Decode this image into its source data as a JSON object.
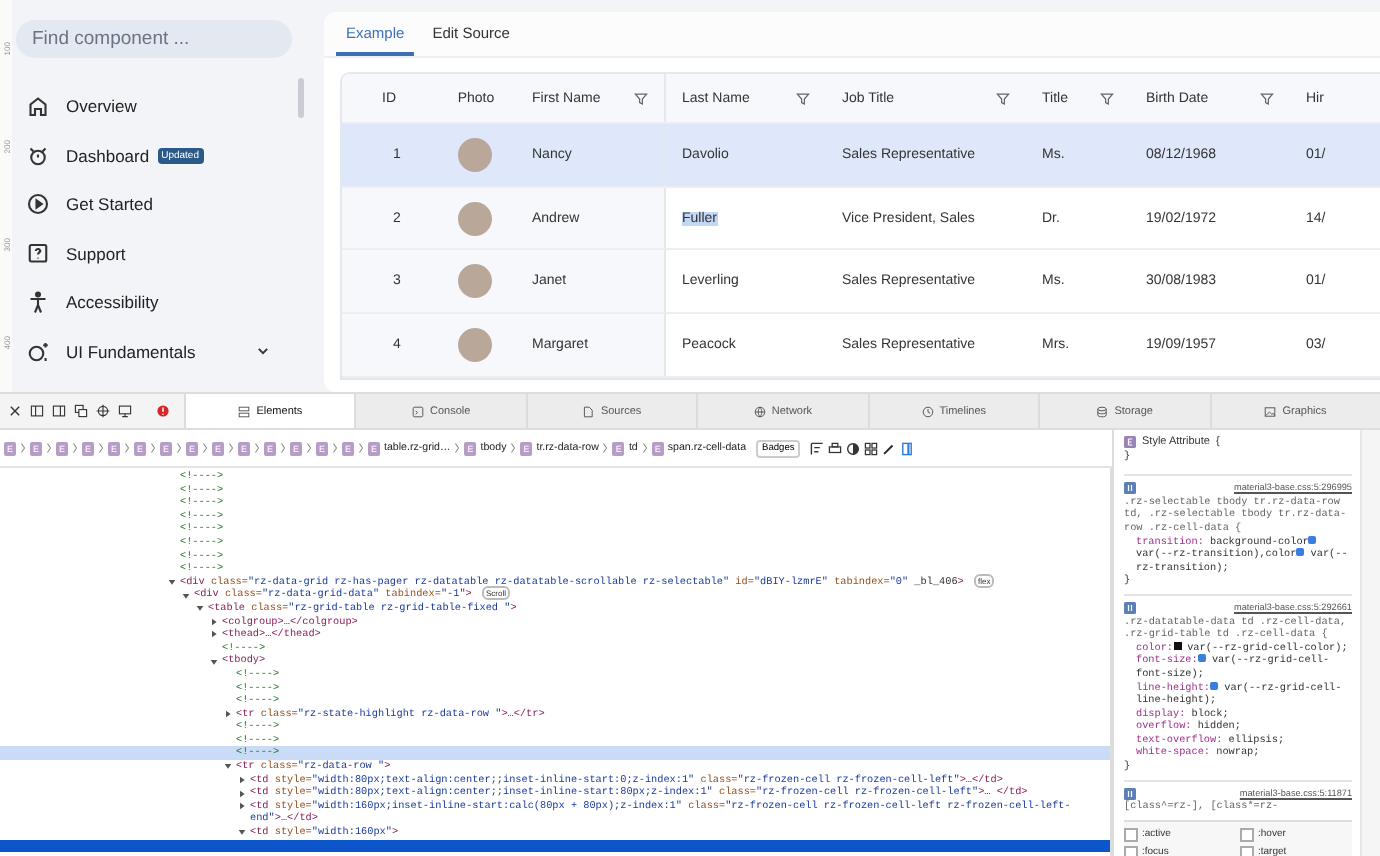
{
  "ruler": [
    "100",
    "200",
    "300",
    "400"
  ],
  "sidebar": {
    "search": {
      "placeholder": "Find component ..."
    },
    "items": [
      {
        "label": "Overview"
      },
      {
        "label": "Dashboard",
        "badge": "Updated"
      },
      {
        "label": "Get Started"
      },
      {
        "label": "Support"
      },
      {
        "label": "Accessibility"
      },
      {
        "label": "UI Fundamentals",
        "expanded": false
      }
    ]
  },
  "tabs": [
    {
      "label": "Example",
      "selected": true
    },
    {
      "label": "Edit Source",
      "selected": false
    }
  ],
  "grid": {
    "columns": [
      {
        "label": "ID",
        "filter": false
      },
      {
        "label": "Photo",
        "filter": false
      },
      {
        "label": "First Name",
        "filter": true
      },
      {
        "label": "Last Name",
        "filter": true
      },
      {
        "label": "Job Title",
        "filter": true
      },
      {
        "label": "Title",
        "filter": true
      },
      {
        "label": "Birth Date",
        "filter": true
      },
      {
        "label": "Hir",
        "filter": false
      }
    ],
    "rows": [
      {
        "selected": true,
        "cells": [
          "1",
          "",
          "Nancy",
          "Davolio",
          "Sales Representative",
          "Ms.",
          "08/12/1968",
          "01/"
        ]
      },
      {
        "selected": false,
        "text_selected": true,
        "cells": [
          "2",
          "",
          "Andrew",
          "Fuller",
          "Vice President, Sales",
          "Dr.",
          "19/02/1972",
          "14/"
        ]
      },
      {
        "selected": false,
        "cells": [
          "3",
          "",
          "Janet",
          "Leverling",
          "Sales Representative",
          "Ms.",
          "30/08/1983",
          "01/"
        ]
      },
      {
        "selected": false,
        "cells": [
          "4",
          "",
          "Margaret",
          "Peacock",
          "Sales Representative",
          "Mrs.",
          "19/09/1957",
          "03/"
        ]
      }
    ]
  },
  "devtools": {
    "tabs": [
      {
        "label": "Elements",
        "selected": true
      },
      {
        "label": "Console",
        "selected": false
      },
      {
        "label": "Sources",
        "selected": false
      },
      {
        "label": "Network",
        "selected": false
      },
      {
        "label": "Timelines",
        "selected": false
      },
      {
        "label": "Storage",
        "selected": false
      },
      {
        "label": "Graphics",
        "selected": false
      }
    ],
    "breadcrumb": [
      {
        "badge": "E"
      },
      {
        "badge": "E"
      },
      {
        "badge": "E"
      },
      {
        "badge": "E"
      },
      {
        "badge": "E"
      },
      {
        "badge": "E"
      },
      {
        "badge": "E"
      },
      {
        "badge": "E"
      },
      {
        "badge": "E"
      },
      {
        "badge": "E"
      },
      {
        "badge": "E"
      },
      {
        "badge": "E"
      },
      {
        "badge": "E"
      },
      {
        "badge": "E"
      },
      {
        "badge": "E",
        "label": "table.rz-grid…"
      },
      {
        "badge": "E",
        "label": "tbody"
      },
      {
        "badge": "E",
        "label": "tr.rz-data-row"
      },
      {
        "badge": "E",
        "label": "td"
      },
      {
        "badge": "E",
        "label": "span.rz-cell-data"
      }
    ],
    "badges_button": "Badges",
    "dom": [
      {
        "text": "<!---->"
      },
      {
        "text": "<!---->"
      },
      {
        "text": "<!---->"
      },
      {
        "text": "<!---->"
      },
      {
        "text": "<!---->"
      },
      {
        "text": "<!---->"
      },
      {
        "text": "<!---->"
      },
      {
        "text": "<!---->"
      },
      {
        "text": "<div class=\"rz-data-grid rz-has-pager rz-datatable rz-datatable-scrollable rz-selectable\" id=\"dBIY-lzmrE\" tabindex=\"0\" _bl_406>",
        "badge": "flex",
        "expanded": true,
        "children": [
          {
            "text": "<div class=\"rz-data-grid-data\" tabindex=\"-1\">",
            "badge": "Scroll",
            "expanded": true,
            "children": [
              {
                "text": "<table class=\"rz-grid-table rz-grid-table-fixed \">",
                "expanded": true,
                "children": [
                  {
                    "text": "<colgroup>…</colgroup>",
                    "expanded": false
                  },
                  {
                    "text": "<thead>…</thead>",
                    "expanded": false
                  },
                  {
                    "text": "<!---->"
                  },
                  {
                    "text": "<tbody>",
                    "expanded": true,
                    "children": [
                      {
                        "text": "<!---->"
                      },
                      {
                        "text": "<!---->"
                      },
                      {
                        "text": "<!---->"
                      },
                      {
                        "text": "<tr class=\"rz-state-highlight rz-data-row \">…</tr>",
                        "expanded": false
                      },
                      {
                        "text": "<!---->"
                      },
                      {
                        "text": "<!---->"
                      },
                      {
                        "text": "<!---->",
                        "hovered": true
                      },
                      {
                        "text": "<tr class=\"rz-data-row \">",
                        "expanded": true,
                        "children": [
                          {
                            "text": "<td style=\"width:80px;text-align:center;;inset-inline-start:0;z-index:1\" class=\"rz-frozen-cell rz-frozen-cell-left\">…</td>",
                            "expanded": false
                          },
                          {
                            "text": "<td style=\"width:80px;text-align:center;;inset-inline-start:80px;z-index:1\" class=\"rz-frozen-cell rz-frozen-cell-left\">… </td>",
                            "expanded": false
                          },
                          {
                            "text": "<td style=\"width:160px;inset-inline-start:calc(80px + 80px);z-index:1\" class=\"rz-frozen-cell rz-frozen-cell-left rz-frozen-cell-left-end\">…</td>",
                            "expanded": false
                          },
                          {
                            "text": "<td style=\"width:160px\">",
                            "expanded": true,
                            "children": [
                              {
                                "selected": true
                              }
                            ]
                          }
                        ]
                      }
                    ]
                  }
                ]
              }
            ]
          }
        ]
      }
    ],
    "styles": {
      "header": "Style Attribute",
      "open": "{",
      "close": "}",
      "rules": [
        {
          "selector": ".rz-selectable tbody tr.rz-data-row td, .rz-selectable tbody tr.rz-data-row .rz-cell-data {",
          "source": "material3-base.css:5:296995",
          "props": [
            {
              "name": "transition:",
              "parts": [
                {
                  "kind": "text",
                  "text": "background-color"
                },
                {
                  "kind": "var"
                },
                {
                  "kind": "text",
                  "text": "var(--rz-transition),color"
                },
                {
                  "kind": "var"
                },
                {
                  "kind": "text",
                  "text": "var(--rz-transition);"
                }
              ]
            }
          ],
          "close": "}"
        },
        {
          "selector": ".rz-datatable-data td .rz-cell-data, .rz-grid-table td .rz-cell-data {",
          "source": "material3-base.css:5:292661",
          "props": [
            {
              "name": "color:",
              "parts": [
                {
                  "kind": "swatch"
                },
                {
                  "kind": "text",
                  "text": "var(--rz-grid-cell-color);"
                }
              ]
            },
            {
              "name": "font-size:",
              "parts": [
                {
                  "kind": "var"
                },
                {
                  "kind": "text",
                  "text": "var(--rz-grid-cell-font-size);"
                }
              ]
            },
            {
              "name": "line-height:",
              "parts": [
                {
                  "kind": "var"
                },
                {
                  "kind": "text",
                  "text": "var(--rz-grid-cell-line-height);"
                }
              ]
            },
            {
              "name": "display:",
              "parts": [
                {
                  "kind": "text",
                  "text": "block;"
                }
              ]
            },
            {
              "name": "overflow:",
              "parts": [
                {
                  "kind": "text",
                  "text": "hidden;"
                }
              ]
            },
            {
              "name": "text-overflow:",
              "parts": [
                {
                  "kind": "text",
                  "text": "ellipsis;"
                }
              ]
            },
            {
              "name": "white-space:",
              "parts": [
                {
                  "kind": "text",
                  "text": "nowrap;"
                }
              ]
            }
          ],
          "close": "}"
        },
        {
          "selector": "[class^=rz-], [class*=rz-",
          "source": "material3-base.css:5:11871"
        }
      ],
      "states": [
        {
          "label": ":active",
          "checked": false
        },
        {
          "label": ":hover",
          "checked": false
        },
        {
          "label": ":focus",
          "checked": false
        },
        {
          "label": ":target",
          "checked": false
        }
      ]
    }
  }
}
